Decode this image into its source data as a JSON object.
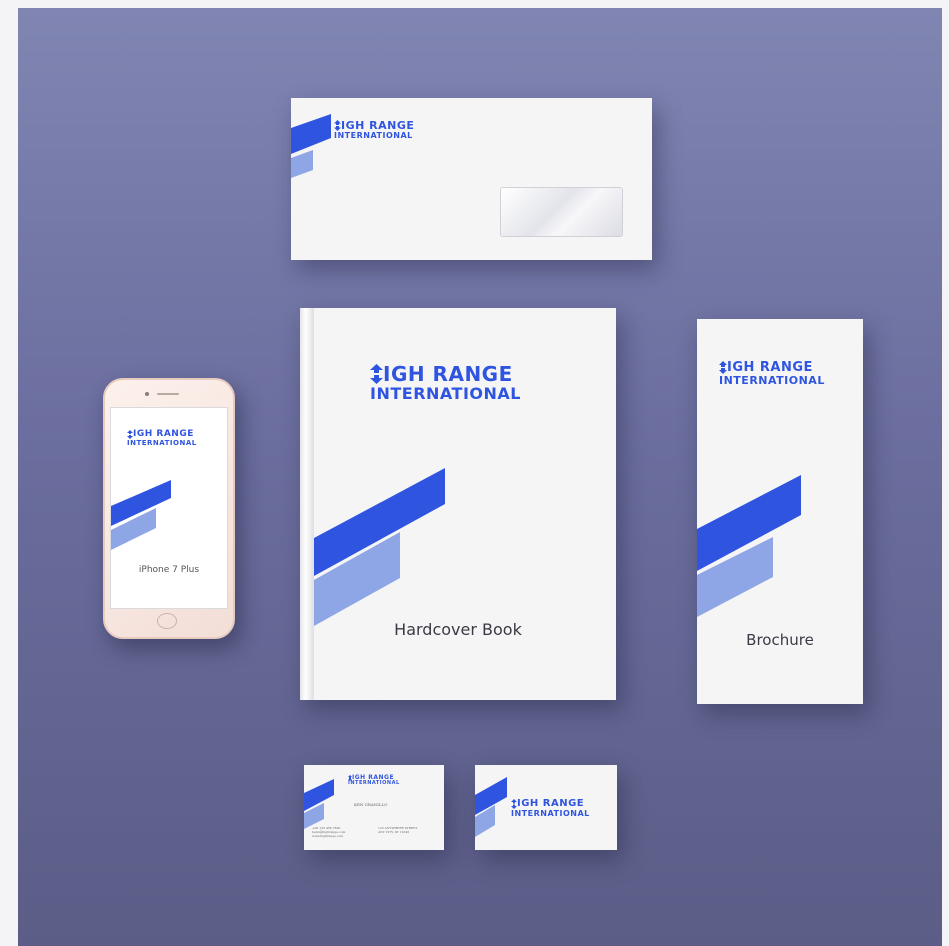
{
  "brand": {
    "name_line1": "IGH RANGE",
    "name_line2": "INTERNATIONAL",
    "primary_color": "#2f55e0",
    "secondary_color": "#8fa6e6",
    "background_top": "#8085b2",
    "background_bottom": "#5b5d87"
  },
  "mockups": {
    "phone": {
      "caption": "iPhone 7 Plus"
    },
    "book": {
      "caption": "Hardcover Book"
    },
    "brochure": {
      "caption": "Brochure"
    }
  },
  "business_card_front": {
    "name": "KEN GRANILLO",
    "contact_left_1": "+00 123 456 7890",
    "contact_left_2": "hello@highrange.com",
    "contact_left_3": "www.highrange.com",
    "contact_right_1": "123 ANYWHERE STREET",
    "contact_right_2": "ANY CITY, ST 12345"
  },
  "icons": {
    "logo_mark": "up-down-arrow-icon"
  }
}
